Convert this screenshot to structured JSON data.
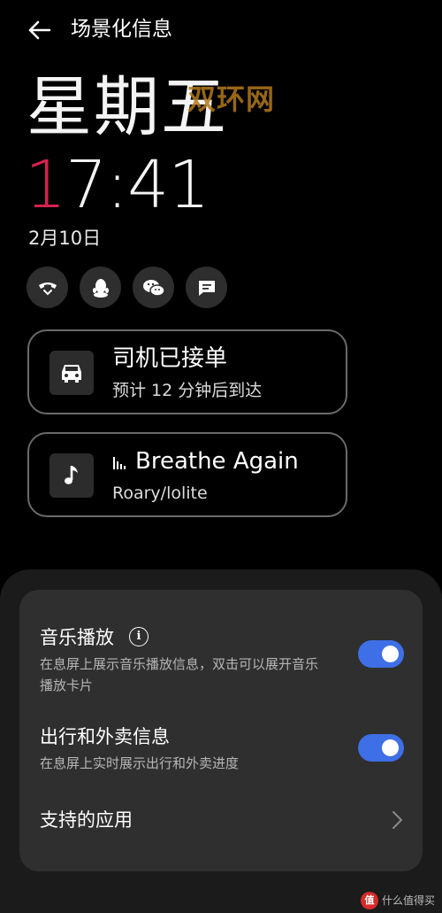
{
  "header": {
    "title": "场景化信息"
  },
  "lockscreen": {
    "weekday": "星期五",
    "watermark": "双环网",
    "time_highlight": "1",
    "time_rest": "7:41",
    "date": "2月10日",
    "notification_icons": [
      "missed-call-icon",
      "qq-icon",
      "wechat-icon",
      "message-icon"
    ],
    "accent_color": "#d4214f"
  },
  "cards": [
    {
      "icon": "car-icon",
      "title": "司机已接单",
      "subtitle": "预计 12 分钟后到达"
    },
    {
      "icon": "music-note-icon",
      "title": "Breathe Again",
      "subtitle": "Roary/lolite"
    }
  ],
  "settings": {
    "music": {
      "title": "音乐播放",
      "description": "在息屏上展示音乐播放信息，双击可以展开音乐播放卡片",
      "enabled": true
    },
    "travel": {
      "title": "出行和外卖信息",
      "description": "在息屏上实时展示出行和外卖进度",
      "enabled": true
    },
    "supported_apps": {
      "title": "支持的应用"
    },
    "toggle_color": "#3e6fe6"
  },
  "footer": {
    "logo_text": "值",
    "label": "什么值得买"
  }
}
